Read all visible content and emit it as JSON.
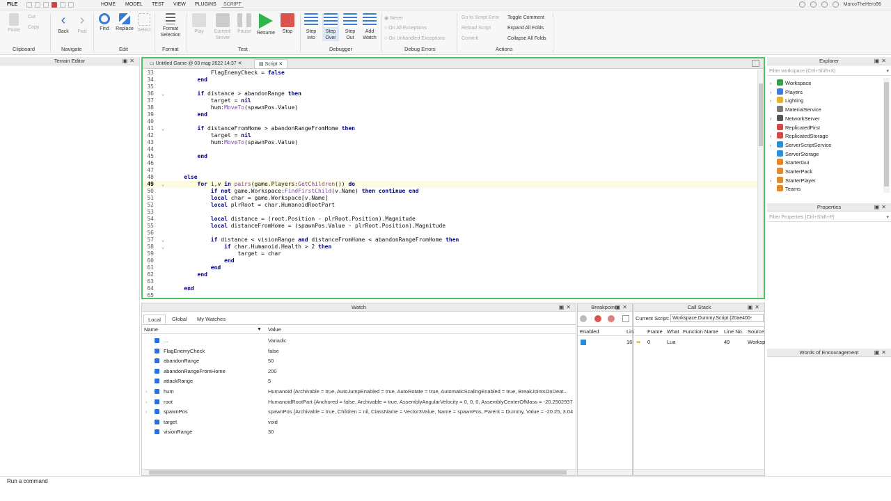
{
  "menu": [
    "FILE",
    "HOME",
    "MODEL",
    "TEST",
    "VIEW",
    "PLUGINS",
    "SCRIPT"
  ],
  "username": "MarcoTheHero96",
  "ribbon": {
    "paste": "Paste",
    "cut": "Cut",
    "copy": "Copy",
    "clipboard": "Clipboard",
    "back": "Back",
    "fwd": "Fwd",
    "navigate": "Navigate",
    "find": "Find",
    "replace": "Replace",
    "select": "Select",
    "edit": "Edit",
    "format_sel1": "Format",
    "format_sel2": "Selection",
    "format": "Format",
    "play": "Play",
    "current1": "Current:",
    "current2": "Server",
    "pause": "Pause",
    "resume": "Resume",
    "stop": "Stop",
    "test": "Test",
    "stepinto1": "Step",
    "stepinto2": "Into",
    "stepover1": "Step",
    "stepover2": "Over",
    "stepout1": "Step",
    "stepout2": "Out",
    "addwatch1": "Add",
    "addwatch2": "Watch",
    "debugger": "Debugger",
    "never": "Never",
    "onall": "On All Exceptions",
    "onunhandled": "On Unhandled Exceptions",
    "debugerrors": "Debug Errors",
    "gotoerror": "Go to Script Error",
    "reload": "Reload Script",
    "commit": "Commit",
    "toggle": "Toggle Comment",
    "expand": "Expand All Folds",
    "collapse": "Collapse All Folds",
    "actions": "Actions"
  },
  "terrain_editor": "Terrain Editor",
  "editor": {
    "tabs": [
      "Untitled Game @ 03 mag 2022 14:37",
      "Script"
    ],
    "current_line": "49",
    "lines": [
      {
        "n": "33",
        "i": "            ",
        "t": "FlagEnemyCheck = false"
      },
      {
        "n": "34",
        "i": "        ",
        "t": "end"
      },
      {
        "n": "35",
        "i": "",
        "t": ""
      },
      {
        "n": "36",
        "i": "        ",
        "t": "if distance > abandonRange then"
      },
      {
        "n": "37",
        "i": "            ",
        "t": "target = nil"
      },
      {
        "n": "38",
        "i": "            ",
        "t": "hum:MoveTo(spawnPos.Value)"
      },
      {
        "n": "39",
        "i": "        ",
        "t": "end"
      },
      {
        "n": "40",
        "i": "",
        "t": ""
      },
      {
        "n": "41",
        "i": "        ",
        "t": "if distanceFromHome > abandonRangeFromHome then"
      },
      {
        "n": "42",
        "i": "            ",
        "t": "target = nil"
      },
      {
        "n": "43",
        "i": "            ",
        "t": "hum:MoveTo(spawnPos.Value)"
      },
      {
        "n": "44",
        "i": "",
        "t": ""
      },
      {
        "n": "45",
        "i": "        ",
        "t": "end"
      },
      {
        "n": "46",
        "i": "",
        "t": ""
      },
      {
        "n": "47",
        "i": "",
        "t": ""
      },
      {
        "n": "48",
        "i": "    ",
        "t": "else"
      },
      {
        "n": "49",
        "i": "        ",
        "t": "for i,v in pairs(game.Players:GetChildren()) do"
      },
      {
        "n": "50",
        "i": "            ",
        "t": "if not game.Workspace:FindFirstChild(v.Name) then continue end"
      },
      {
        "n": "51",
        "i": "            ",
        "t": "local char = game.Workspace[v.Name]"
      },
      {
        "n": "52",
        "i": "            ",
        "t": "local plrRoot = char.HumanoidRootPart"
      },
      {
        "n": "53",
        "i": "",
        "t": ""
      },
      {
        "n": "54",
        "i": "            ",
        "t": "local distance = (root.Position - plrRoot.Position).Magnitude"
      },
      {
        "n": "55",
        "i": "            ",
        "t": "local distanceFromHome = (spawnPos.Value - plrRoot.Position).Magnitude"
      },
      {
        "n": "56",
        "i": "",
        "t": ""
      },
      {
        "n": "57",
        "i": "            ",
        "t": "if distance < visionRange and distanceFromHome < abandonRangeFromHome then"
      },
      {
        "n": "58",
        "i": "                ",
        "t": "if char.Humanoid.Health > 2 then"
      },
      {
        "n": "59",
        "i": "                    ",
        "t": "target = char"
      },
      {
        "n": "60",
        "i": "                ",
        "t": "end"
      },
      {
        "n": "61",
        "i": "            ",
        "t": "end"
      },
      {
        "n": "62",
        "i": "        ",
        "t": "end"
      },
      {
        "n": "63",
        "i": "",
        "t": ""
      },
      {
        "n": "64",
        "i": "    ",
        "t": "end"
      },
      {
        "n": "65",
        "i": "",
        "t": ""
      }
    ]
  },
  "watch": {
    "title": "Watch",
    "tabs": [
      "Local",
      "Global",
      "My Watches"
    ],
    "col_name": "Name",
    "col_value": "Value",
    "rows": [
      {
        "name": "...",
        "value": "Variadic",
        "exp": false
      },
      {
        "name": "FlagEnemyCheck",
        "value": "false",
        "exp": false
      },
      {
        "name": "abandonRange",
        "value": "50",
        "exp": false
      },
      {
        "name": "abandonRangeFromHome",
        "value": "200",
        "exp": false
      },
      {
        "name": "attackRange",
        "value": "5",
        "exp": false
      },
      {
        "name": "hum",
        "value": "Humanoid {Archivable = true, AutoJumpEnabled = true, AutoRotate = true, AutomaticScalingEnabled = true, BreakJointsOnDeat...",
        "exp": true
      },
      {
        "name": "root",
        "value": "HumanoidRootPart {Anchored = false, Archivable = true, AssemblyAngularVelocity = 0, 0, 0, AssemblyCenterOfMass = -20.2502937,...",
        "exp": true
      },
      {
        "name": "spawnPos",
        "value": "spawnPos {Archivable = true, Children = nil, ClassName = Vector3Value, Name = spawnPos, Parent = Dummy, Value = -20.25, 3.040...",
        "exp": true
      },
      {
        "name": "target",
        "value": "void",
        "exp": false
      },
      {
        "name": "visionRange",
        "value": "30",
        "exp": false
      }
    ]
  },
  "breakpoints": {
    "title": "Breakpoints",
    "col_enabled": "Enabled",
    "col_line": "Lin",
    "line_val": "16"
  },
  "callstack": {
    "title": "Call Stack",
    "current_label": "Current Script:",
    "current_value": "Workspace.Dummy.Script (20ae400-",
    "cols": [
      "Frame",
      "What",
      "Function Name",
      "Line No.",
      "Source"
    ],
    "row": {
      "frame": "0",
      "what": "Lua",
      "fname": "",
      "line": "49",
      "source": "Worksp"
    }
  },
  "explorer": {
    "title": "Explorer",
    "filter": "Filter workspace (Ctrl+Shift+X)",
    "items": [
      {
        "label": "Workspace",
        "arrow": true,
        "color": "#3a9e4a"
      },
      {
        "label": "Players",
        "arrow": true,
        "color": "#3f7ad6"
      },
      {
        "label": "Lighting",
        "arrow": true,
        "color": "#e3b42b"
      },
      {
        "label": "MaterialService",
        "arrow": false,
        "color": "#7a7a7a"
      },
      {
        "label": "NetworkServer",
        "arrow": true,
        "color": "#555555"
      },
      {
        "label": "ReplicatedFirst",
        "arrow": false,
        "color": "#d14a4a"
      },
      {
        "label": "ReplicatedStorage",
        "arrow": true,
        "color": "#d14a4a"
      },
      {
        "label": "ServerScriptService",
        "arrow": true,
        "color": "#2d8fd6"
      },
      {
        "label": "ServerStorage",
        "arrow": false,
        "color": "#2d8fd6"
      },
      {
        "label": "StarterGui",
        "arrow": false,
        "color": "#e08a2b"
      },
      {
        "label": "StarterPack",
        "arrow": false,
        "color": "#e08a2b"
      },
      {
        "label": "StarterPlayer",
        "arrow": true,
        "color": "#e08a2b"
      },
      {
        "label": "Teams",
        "arrow": false,
        "color": "#e08a2b"
      }
    ]
  },
  "properties": {
    "title": "Properties",
    "filter": "Filter Properties (Ctrl+Shift+P)"
  },
  "encouragement": "Words of Encouragement",
  "command": "Run a command"
}
